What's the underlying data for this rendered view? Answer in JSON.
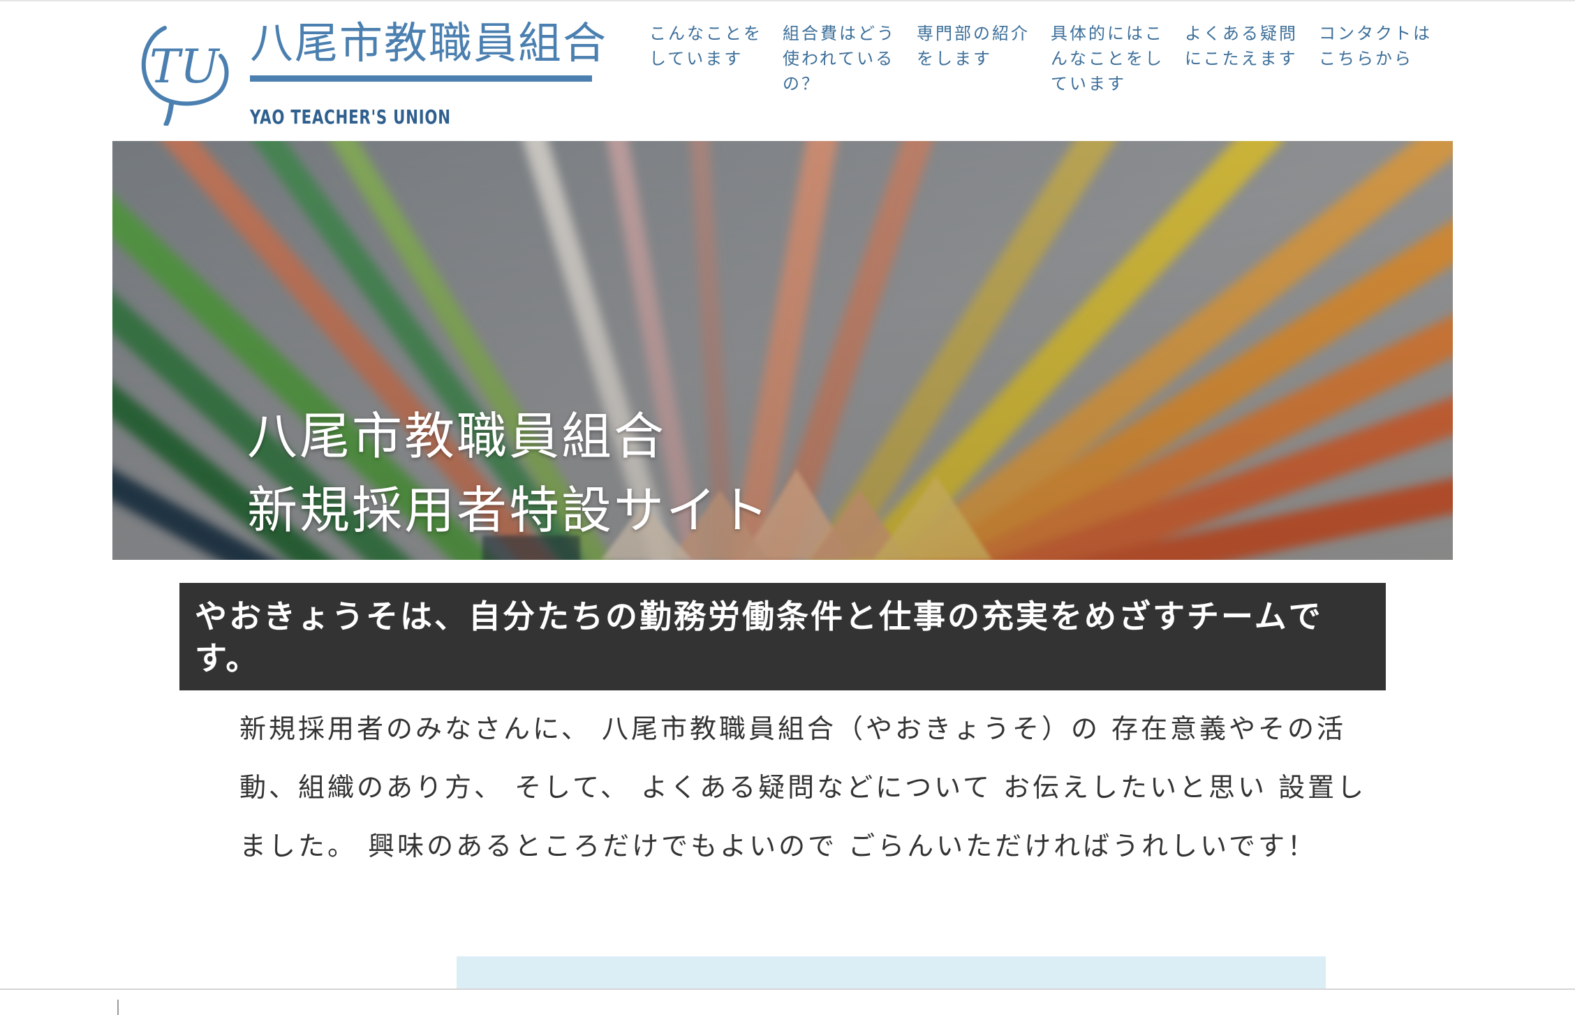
{
  "header": {
    "logo_mark_text": "TU",
    "logo_title": "八尾市教職員組合",
    "logo_subtitle": "YAO TEACHER'S UNION",
    "brand_color": "#4a7fb0"
  },
  "nav": {
    "items": [
      {
        "label": "こんなことをしています"
      },
      {
        "label": "組合費はどう使われているの？"
      },
      {
        "label": "専門部の紹介をします"
      },
      {
        "label": "具体的にはこんなことをしています"
      },
      {
        "label": "よくある疑問にこたえます"
      },
      {
        "label": "コンタクトはこちらから"
      }
    ]
  },
  "hero": {
    "title_line1": "八尾市教職員組合",
    "title_line2": "新規採用者特設サイト",
    "image": "colored-pencils-photo"
  },
  "intro": {
    "tagline": "やおきょうそは、自分たちの勤務労働条件と仕事の充実をめざすチームです。",
    "lead": "新規採用者のみなさんに、 八尾市教職員組合（やおきょうそ）の 存在意義やその活動、組織のあり方、 そして、 よくある疑問などについて お伝えしたいと思い 設置しました。 興味のあるところだけでもよいので ごらんいただければうれしいです！"
  },
  "colors": {
    "nav_text": "#3d6f9a",
    "tagline_bg": "#333333",
    "info_band": "#dbeef6"
  }
}
